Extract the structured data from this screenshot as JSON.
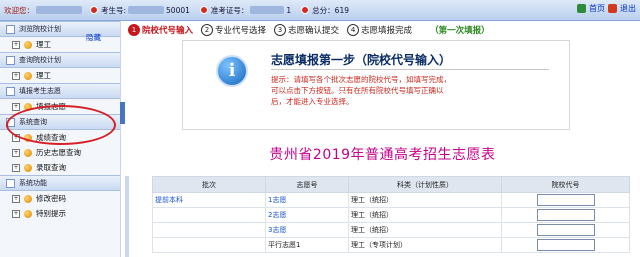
{
  "header": {
    "welcome": "欢迎您：",
    "candidate_label": "考生号:",
    "candidate_value": "50001",
    "ticket_label": "准考证号：",
    "ticket_value": "1",
    "score_label": "总分：",
    "score_value": "619",
    "home": "首页",
    "exit": "退出"
  },
  "sidebar": {
    "collapse_hint": "隐藏",
    "groups": [
      {
        "label": "浏览院校计划",
        "items": [
          "理工"
        ]
      },
      {
        "label": "查询院校计划",
        "items": [
          "理工"
        ]
      },
      {
        "label": "填报考生志愿",
        "items": [
          "填报志愿"
        ]
      },
      {
        "label": "系统查询",
        "items": [
          "成绩查询",
          "历史志愿查询",
          "录取查询"
        ]
      },
      {
        "label": "系统功能",
        "items": [
          "修改密码",
          "特别提示"
        ]
      }
    ]
  },
  "steps": {
    "items": [
      {
        "num": "1",
        "label": "院校代号输入",
        "active": true
      },
      {
        "num": "2",
        "label": "专业代号选择",
        "active": false
      },
      {
        "num": "3",
        "label": "志愿确认提交",
        "active": false
      },
      {
        "num": "4",
        "label": "志愿填报完成",
        "active": false
      }
    ],
    "batch": "（第一次填报）"
  },
  "info": {
    "icon": "info-icon",
    "title": "志愿填报第一步（院校代号输入）",
    "tip_line1": "提示：请填写各个批次志愿的院校代号，如填写完成，",
    "tip_line2": "可以点击下方按钮。只有在所有院校代号填写正确以",
    "tip_line3": "后，才能进入专业选择。"
  },
  "page_title": "贵州省2019年普通高考招生志愿表",
  "table": {
    "headers": [
      "批次",
      "志愿号",
      "科类（计划性质）",
      "院校代号"
    ],
    "rows": [
      {
        "batch": "提前本科",
        "vol": "1志愿",
        "cat": "理工（统招）"
      },
      {
        "batch": "",
        "vol": "2志愿",
        "cat": "理工（统招）"
      },
      {
        "batch": "",
        "vol": "3志愿",
        "cat": "理工（统招）"
      },
      {
        "batch": "",
        "vol": "平行志愿1",
        "cat": "理工（专项计划）"
      }
    ]
  },
  "colors": {
    "accent_red": "#c8161d",
    "title_magenta": "#c6008d",
    "navy": "#0a2c66"
  }
}
